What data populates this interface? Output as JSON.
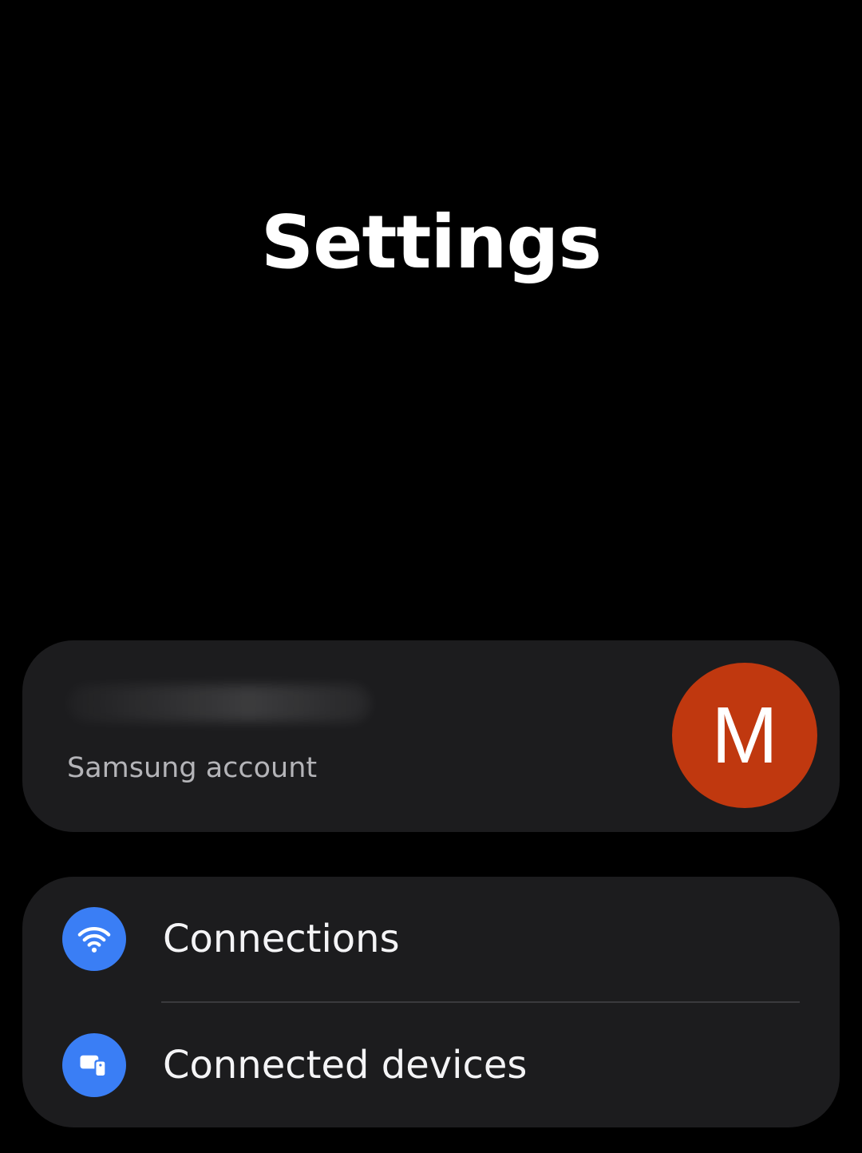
{
  "header": {
    "title": "Settings"
  },
  "account": {
    "subtitle": "Samsung account",
    "avatar_initial": "M",
    "avatar_color": "#c0380f"
  },
  "menu": {
    "items": [
      {
        "label": "Connections",
        "icon": "wifi-icon",
        "icon_bg": "#3a7ef5"
      },
      {
        "label": "Connected devices",
        "icon": "connected-devices-icon",
        "icon_bg": "#3a7ef5"
      }
    ]
  }
}
